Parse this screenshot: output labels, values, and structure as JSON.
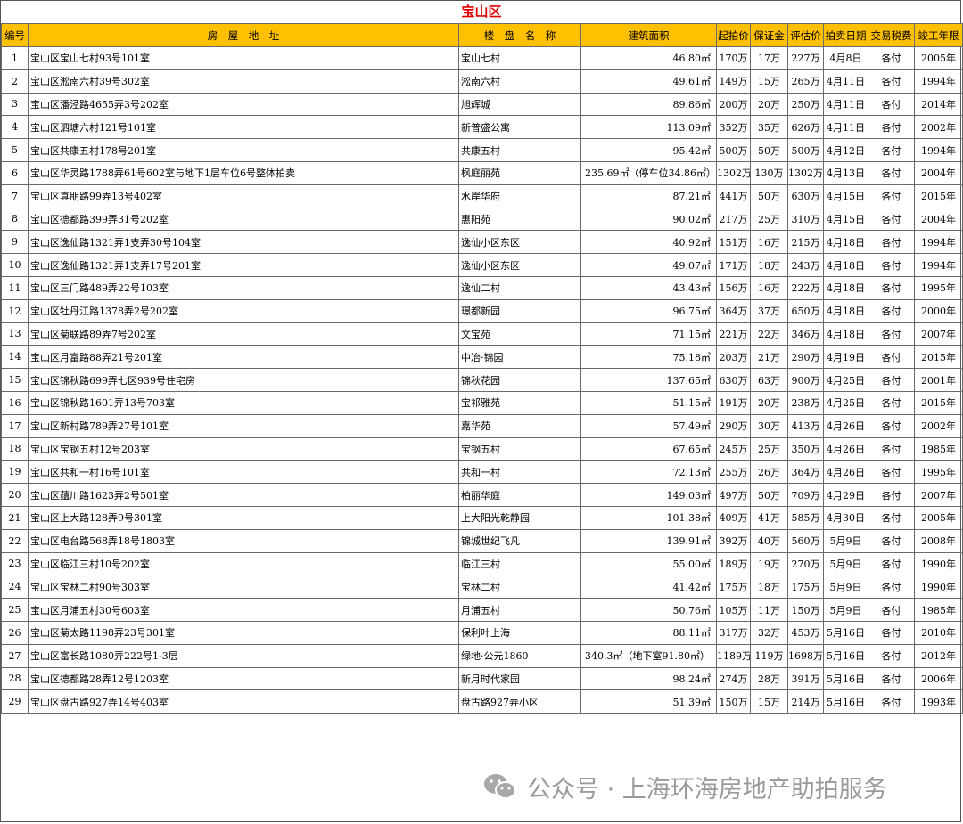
{
  "title": "宝山区",
  "columns": [
    "编号",
    "房　屋　地　址",
    "楼　盘　名　称",
    "建筑面积",
    "起拍价",
    "保证金",
    "评估价",
    "拍卖日期",
    "交易税费",
    "竣工年限"
  ],
  "rows": [
    [
      "1",
      "宝山区宝山七村93号101室",
      "宝山七村",
      "46.80㎡",
      "170万",
      "17万",
      "227万",
      "4月8日",
      "各付",
      "2005年"
    ],
    [
      "2",
      "宝山区淞南六村39号302室",
      "淞南六村",
      "49.61㎡",
      "149万",
      "15万",
      "265万",
      "4月11日",
      "各付",
      "1994年"
    ],
    [
      "3",
      "宝山区潘泾路4655弄3号202室",
      "旭辉城",
      "89.86㎡",
      "200万",
      "20万",
      "250万",
      "4月11日",
      "各付",
      "2014年"
    ],
    [
      "4",
      "宝山区泗塘六村121号101室",
      "新普盛公寓",
      "113.09㎡",
      "352万",
      "35万",
      "626万",
      "4月11日",
      "各付",
      "2002年"
    ],
    [
      "5",
      "宝山区共康五村178号201室",
      "共康五村",
      "95.42㎡",
      "500万",
      "50万",
      "500万",
      "4月12日",
      "各付",
      "1994年"
    ],
    [
      "6",
      "宝山区华灵路1788弄61号602室与地下1层车位6号整体拍卖",
      "枫庭丽苑",
      "235.69㎡（停车位34.86㎡）",
      "1302万",
      "130万",
      "1302万",
      "4月13日",
      "各付",
      "2004年"
    ],
    [
      "7",
      "宝山区真朋路99弄13号402室",
      "水岸华府",
      "87.21㎡",
      "441万",
      "50万",
      "630万",
      "4月15日",
      "各付",
      "2015年"
    ],
    [
      "8",
      "宝山区德都路399弄31号202室",
      "惠阳苑",
      "90.02㎡",
      "217万",
      "25万",
      "310万",
      "4月15日",
      "各付",
      "2004年"
    ],
    [
      "9",
      "宝山区逸仙路1321弄1支弄30号104室",
      "逸仙小区东区",
      "40.92㎡",
      "151万",
      "16万",
      "215万",
      "4月18日",
      "各付",
      "1994年"
    ],
    [
      "10",
      "宝山区逸仙路1321弄1支弄17号201室",
      "逸仙小区东区",
      "49.07㎡",
      "171万",
      "18万",
      "243万",
      "4月18日",
      "各付",
      "1994年"
    ],
    [
      "11",
      "宝山区三门路489弄22号103室",
      "逸仙二村",
      "43.43㎡",
      "156万",
      "16万",
      "222万",
      "4月18日",
      "各付",
      "1995年"
    ],
    [
      "12",
      "宝山区牡丹江路1378弄2号202室",
      "璟都新园",
      "96.75㎡",
      "364万",
      "37万",
      "650万",
      "4月18日",
      "各付",
      "2000年"
    ],
    [
      "13",
      "宝山区菊联路89弄7号202室",
      "文宝苑",
      "71.15㎡",
      "221万",
      "22万",
      "346万",
      "4月18日",
      "各付",
      "2007年"
    ],
    [
      "14",
      "宝山区月富路88弄21号201室",
      "中冶·锦园",
      "75.18㎡",
      "203万",
      "21万",
      "290万",
      "4月19日",
      "各付",
      "2015年"
    ],
    [
      "15",
      "宝山区锦秋路699弄七区939号住宅房",
      "锦秋花园",
      "137.65㎡",
      "630万",
      "63万",
      "900万",
      "4月25日",
      "各付",
      "2001年"
    ],
    [
      "16",
      "宝山区锦秋路1601弄13号703室",
      "宝祁雅苑",
      "51.15㎡",
      "191万",
      "20万",
      "238万",
      "4月25日",
      "各付",
      "2015年"
    ],
    [
      "17",
      "宝山区新村路789弄27号101室",
      "嘉华苑",
      "57.49㎡",
      "290万",
      "30万",
      "413万",
      "4月26日",
      "各付",
      "2002年"
    ],
    [
      "18",
      "宝山区宝钢五村12号203室",
      "宝钢五村",
      "67.65㎡",
      "245万",
      "25万",
      "350万",
      "4月26日",
      "各付",
      "1985年"
    ],
    [
      "19",
      "宝山区共和一村16号101室",
      "共和一村",
      "72.13㎡",
      "255万",
      "26万",
      "364万",
      "4月26日",
      "各付",
      "1995年"
    ],
    [
      "20",
      "宝山区蕴川路1623弄2号501室",
      "柏丽华庭",
      "149.03㎡",
      "497万",
      "50万",
      "709万",
      "4月29日",
      "各付",
      "2007年"
    ],
    [
      "21",
      "宝山区上大路128弄9号301室",
      "上大阳光乾静园",
      "101.38㎡",
      "409万",
      "41万",
      "585万",
      "4月30日",
      "各付",
      "2005年"
    ],
    [
      "22",
      "宝山区电台路568弄18号1803室",
      "锦城世纪飞凡",
      "139.91㎡",
      "392万",
      "40万",
      "560万",
      "5月9日",
      "各付",
      "2008年"
    ],
    [
      "23",
      "宝山区临江三村10号202室",
      "临江三村",
      "55.00㎡",
      "189万",
      "19万",
      "270万",
      "5月9日",
      "各付",
      "1990年"
    ],
    [
      "24",
      "宝山区宝林二村90号303室",
      "宝林二村",
      "41.42㎡",
      "175万",
      "18万",
      "175万",
      "5月9日",
      "各付",
      "1990年"
    ],
    [
      "25",
      "宝山区月浦五村30号603室",
      "月浦五村",
      "50.76㎡",
      "105万",
      "11万",
      "150万",
      "5月9日",
      "各付",
      "1985年"
    ],
    [
      "26",
      "宝山区菊太路1198弄23号301室",
      "保利叶上海",
      "88.11㎡",
      "317万",
      "32万",
      "453万",
      "5月16日",
      "各付",
      "2010年"
    ],
    [
      "27",
      "宝山区富长路1080弄222号1-3层",
      "绿地·公元1860",
      "340.3㎡（地下室91.80㎡）",
      "1189万",
      "119万",
      "1698万",
      "5月16日",
      "各付",
      "2012年"
    ],
    [
      "28",
      "宝山区德都路28弄12号1203室",
      "新月时代家园",
      "98.24㎡",
      "274万",
      "28万",
      "391万",
      "5月16日",
      "各付",
      "2006年"
    ],
    [
      "29",
      "宝山区盘古路927弄14号403室",
      "盘古路927弄小区",
      "51.39㎡",
      "150万",
      "15万",
      "214万",
      "5月16日",
      "各付",
      "1993年"
    ]
  ],
  "watermark": {
    "text": "公众号 · 上海环海房地产助拍服务",
    "icon": "wechat-icon"
  }
}
